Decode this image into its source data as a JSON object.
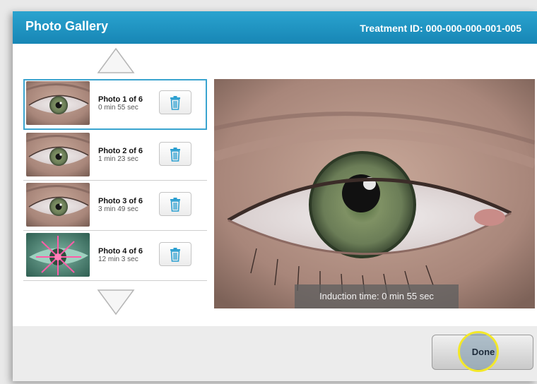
{
  "header": {
    "title": "Photo Gallery",
    "treatment_id": "Treatment ID:  000-000-000-001-005"
  },
  "photos": [
    {
      "title": "Photo 1 of 6",
      "time": "0 min 55 sec",
      "selected": true
    },
    {
      "title": "Photo 2 of 6",
      "time": "1 min 23 sec",
      "selected": false
    },
    {
      "title": "Photo 3 of 6",
      "time": "3 min 49 sec",
      "selected": false
    },
    {
      "title": "Photo 4 of 6",
      "time": "12 min 3 sec",
      "selected": false
    }
  ],
  "viewer": {
    "induction_label": "Induction time: 0 min 55 sec"
  },
  "footer": {
    "done_label": "Done"
  },
  "colors": {
    "header": "#1786b5",
    "accent_border": "#3aa4cf",
    "trash_icon": "#2b9fd0",
    "highlight_ring": "#f3e82a"
  },
  "icons": [
    "scroll-up-arrow-icon",
    "scroll-down-arrow-icon",
    "trash-icon"
  ]
}
